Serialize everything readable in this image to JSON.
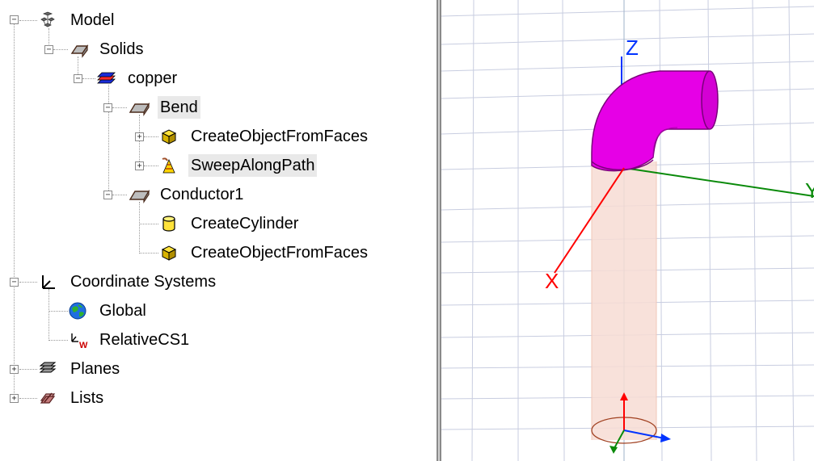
{
  "tree": {
    "model": {
      "label": "Model",
      "icon": "model-icon"
    },
    "solids": {
      "label": "Solids",
      "icon": "solid-group-icon"
    },
    "copper": {
      "label": "copper",
      "icon": "material-stack-icon"
    },
    "bend": {
      "label": "Bend",
      "icon": "solid-object-icon"
    },
    "create_object_from_faces_1": {
      "label": "CreateObjectFromFaces",
      "icon": "create-object-icon"
    },
    "sweep_along_path": {
      "label": "SweepAlongPath",
      "icon": "sweep-icon"
    },
    "conductor1": {
      "label": "Conductor1",
      "icon": "solid-object-icon"
    },
    "create_cylinder": {
      "label": "CreateCylinder",
      "icon": "cylinder-icon"
    },
    "create_object_from_faces_2": {
      "label": "CreateObjectFromFaces",
      "icon": "create-object-icon"
    },
    "coordinate_systems": {
      "label": "Coordinate Systems",
      "icon": "axes-icon"
    },
    "global": {
      "label": "Global",
      "icon": "globe-icon"
    },
    "relative_cs1": {
      "label": "RelativeCS1",
      "icon": "relative-cs-icon"
    },
    "planes": {
      "label": "Planes",
      "icon": "planes-icon"
    },
    "lists": {
      "label": "Lists",
      "icon": "lists-icon"
    }
  },
  "viewport": {
    "axis_z": "Z",
    "axis_y": "Y",
    "axis_x": "X",
    "colors": {
      "bend": "#e600e6",
      "x_axis": "#ff0000",
      "y_axis": "#008000",
      "z_axis": "#0033ff",
      "grid": "#c8cde0",
      "cylinder": "#f7dcd3"
    }
  }
}
